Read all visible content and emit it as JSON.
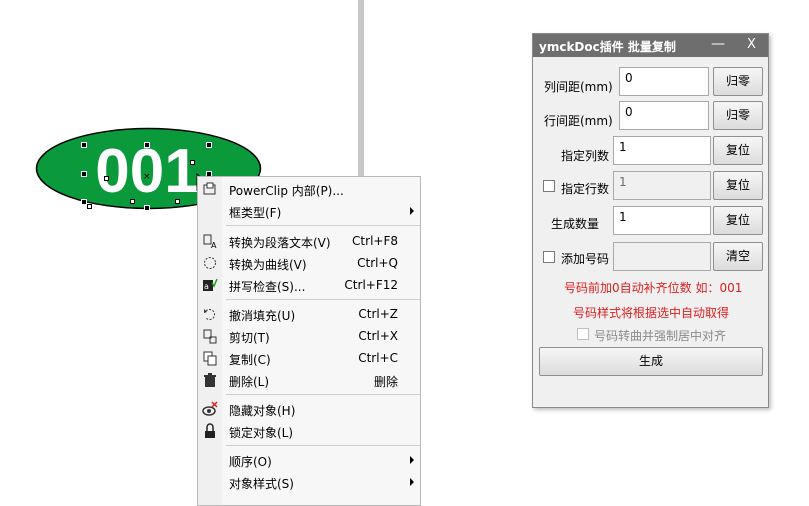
{
  "ellipse": {
    "text": "001",
    "fill": "#0a9a3c",
    "text_color": "#ffffff"
  },
  "context_menu": {
    "items": [
      {
        "label": "PowerClip 内部(P)...",
        "shortcut": "",
        "submenu": false,
        "icon": "powerclip-icon"
      },
      {
        "label": "框类型(F)",
        "shortcut": "",
        "submenu": true,
        "icon": ""
      },
      {
        "label": "转换为段落文本(V)",
        "shortcut": "Ctrl+F8",
        "submenu": false,
        "icon": "paragraph-text-icon"
      },
      {
        "label": "转换为曲线(V)",
        "shortcut": "Ctrl+Q",
        "submenu": false,
        "icon": "curve-icon"
      },
      {
        "label": "拼写检查(S)...",
        "shortcut": "Ctrl+F12",
        "submenu": false,
        "icon": "spellcheck-icon"
      },
      {
        "label": "撤消填充(U)",
        "shortcut": "Ctrl+Z",
        "submenu": false,
        "icon": "undo-icon"
      },
      {
        "label": "剪切(T)",
        "shortcut": "Ctrl+X",
        "submenu": false,
        "icon": "cut-icon"
      },
      {
        "label": "复制(C)",
        "shortcut": "Ctrl+C",
        "submenu": false,
        "icon": "copy-icon"
      },
      {
        "label": "删除(L)",
        "shortcut": "删除",
        "submenu": false,
        "icon": "trash-icon"
      },
      {
        "label": "隐藏对象(H)",
        "shortcut": "",
        "submenu": false,
        "icon": "hide-icon"
      },
      {
        "label": "锁定对象(L)",
        "shortcut": "",
        "submenu": false,
        "icon": "lock-icon"
      },
      {
        "label": "顺序(O)",
        "shortcut": "",
        "submenu": true,
        "icon": ""
      },
      {
        "label": "对象样式(S)",
        "shortcut": "",
        "submenu": true,
        "icon": ""
      }
    ]
  },
  "panel": {
    "title": "ymckDoc插件  批量复制",
    "minimize": "—",
    "close": "X",
    "col_gap_label": "列间距(mm)",
    "col_gap_value": "0",
    "col_gap_button": "归零",
    "row_gap_label": "行间距(mm)",
    "row_gap_value": "0",
    "row_gap_button": "归零",
    "cols_label": "指定列数",
    "cols_value": "1",
    "cols_button": "复位",
    "rows_label": "指定行数",
    "rows_value": "1",
    "rows_button": "复位",
    "count_label": "生成数量",
    "count_value": "1",
    "count_button": "复位",
    "number_label": "添加号码",
    "number_value": "",
    "number_button": "清空",
    "note1": "号码前加0自动补齐位数 如：001",
    "note2": "号码样式将根据选中自动取得",
    "align_label": "号码转曲并强制居中对齐",
    "generate_button": "生成"
  },
  "colors": {
    "note": "#e02020",
    "titlebar": "#6e6e6e",
    "ellipse": "#0a9a3c"
  }
}
